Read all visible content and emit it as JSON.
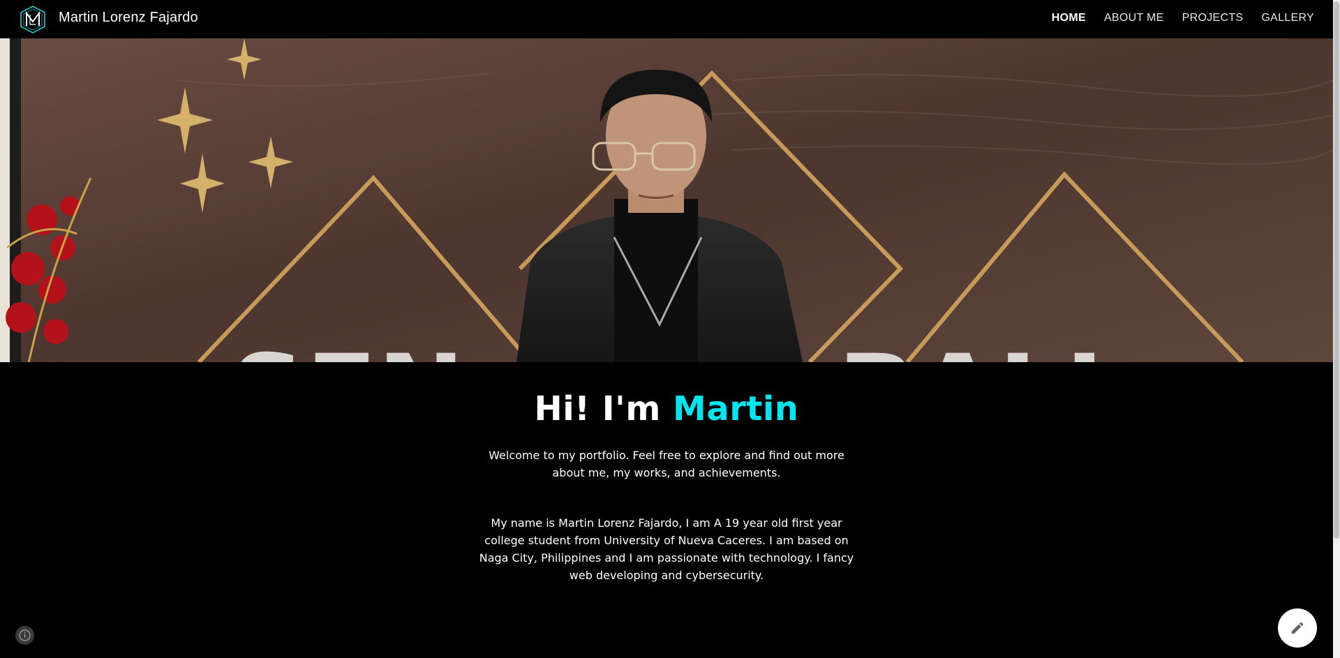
{
  "header": {
    "site_title": "Martin Lorenz Fajardo",
    "logo_icon": "ml-monogram-logo",
    "nav": [
      {
        "label": "HOME",
        "active": true
      },
      {
        "label": "ABOUT ME",
        "active": false
      },
      {
        "label": "PROJECTS",
        "active": false
      },
      {
        "label": "GALLERY",
        "active": false
      }
    ]
  },
  "hero": {
    "photo": "portrait-at-senior-ball-backdrop",
    "backdrop_text": "SENIOR BALL"
  },
  "main": {
    "greeting_prefix": "Hi! I'm ",
    "greeting_name": "Martin",
    "welcome": "Welcome to my portfolio. Feel free to explore and find out more about me, my works, and achievements.",
    "bio": "My name is Martin Lorenz Fajardo, I am A 19 year old first year college student from University of Nueva Caceres. I am based on Naga City, Philippines and I am passionate with technology. I fancy web developing and cybersecurity."
  },
  "colors": {
    "accent": "#00e5ee",
    "background": "#000000",
    "text": "#ffffff"
  },
  "floating": {
    "info_icon": "info-icon",
    "edit_icon": "pencil-icon"
  }
}
